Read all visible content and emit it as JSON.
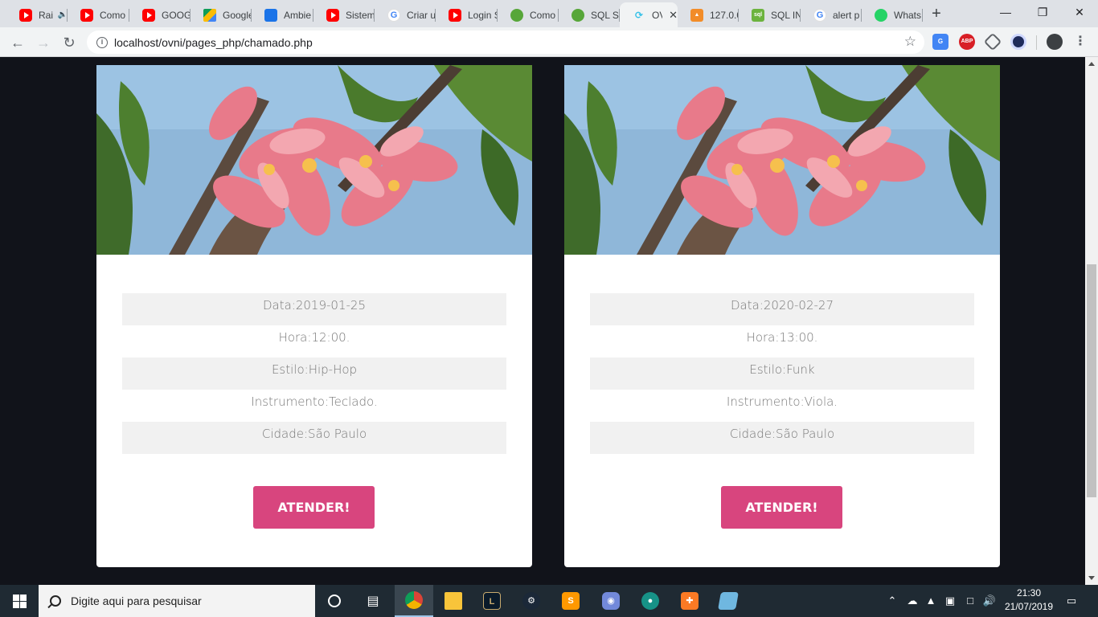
{
  "browser": {
    "tabs": [
      {
        "label": "Rai",
        "favicon": "youtube-icon",
        "audio": "speaker-icon"
      },
      {
        "label": "Como",
        "favicon": "youtube-icon"
      },
      {
        "label": "GOOG",
        "favicon": "youtube-icon"
      },
      {
        "label": "Google",
        "favicon": "google-drive-icon"
      },
      {
        "label": "Ambie",
        "favicon": "book-icon"
      },
      {
        "label": "Sistem",
        "favicon": "youtube-icon"
      },
      {
        "label": "Criar u",
        "favicon": "google-icon"
      },
      {
        "label": "Login S",
        "favicon": "youtube-icon"
      },
      {
        "label": "Como",
        "favicon": "green-logo-icon"
      },
      {
        "label": "SQL SE",
        "favicon": "green-logo-icon"
      },
      {
        "label": "OV",
        "favicon": "loading-icon",
        "active": true
      },
      {
        "label": "127.0.0",
        "favicon": "phpmyadmin-icon"
      },
      {
        "label": "SQL IN",
        "favicon": "sqlinfo-icon"
      },
      {
        "label": "alert p",
        "favicon": "google-icon"
      },
      {
        "label": "Whats",
        "favicon": "whatsapp-icon"
      }
    ],
    "url": "localhost/ovni/pages_php/chamado.php"
  },
  "cards": [
    {
      "data_label": "Data:",
      "data_value": "2019-01-25",
      "hora_label": "Hora:",
      "hora_value": "12:00.",
      "estilo_label": "Estilo:",
      "estilo_value": "Hip-Hop",
      "instrumento_label": "Instrumento:",
      "instrumento_value": "Teclado.",
      "cidade_label": "Cidade:",
      "cidade_value": "São Paulo",
      "button_label": "ATENDER!"
    },
    {
      "data_label": "Data:",
      "data_value": "2020-02-27",
      "hora_label": "Hora:",
      "hora_value": "13:00.",
      "estilo_label": "Estilo:",
      "estilo_value": "Funk",
      "instrumento_label": "Instrumento:",
      "instrumento_value": "Viola.",
      "cidade_label": "Cidade:",
      "cidade_value": "São Paulo",
      "button_label": "ATENDER!"
    }
  ],
  "taskbar": {
    "search_placeholder": "Digite aqui para pesquisar",
    "time": "21:30",
    "date": "21/07/2019"
  },
  "colors": {
    "page_background": "#11131a",
    "card_background": "#ffffff",
    "button_accent": "#d8457e",
    "stripe_row": "#f1f1f1",
    "taskbar": "#1f2a33"
  }
}
